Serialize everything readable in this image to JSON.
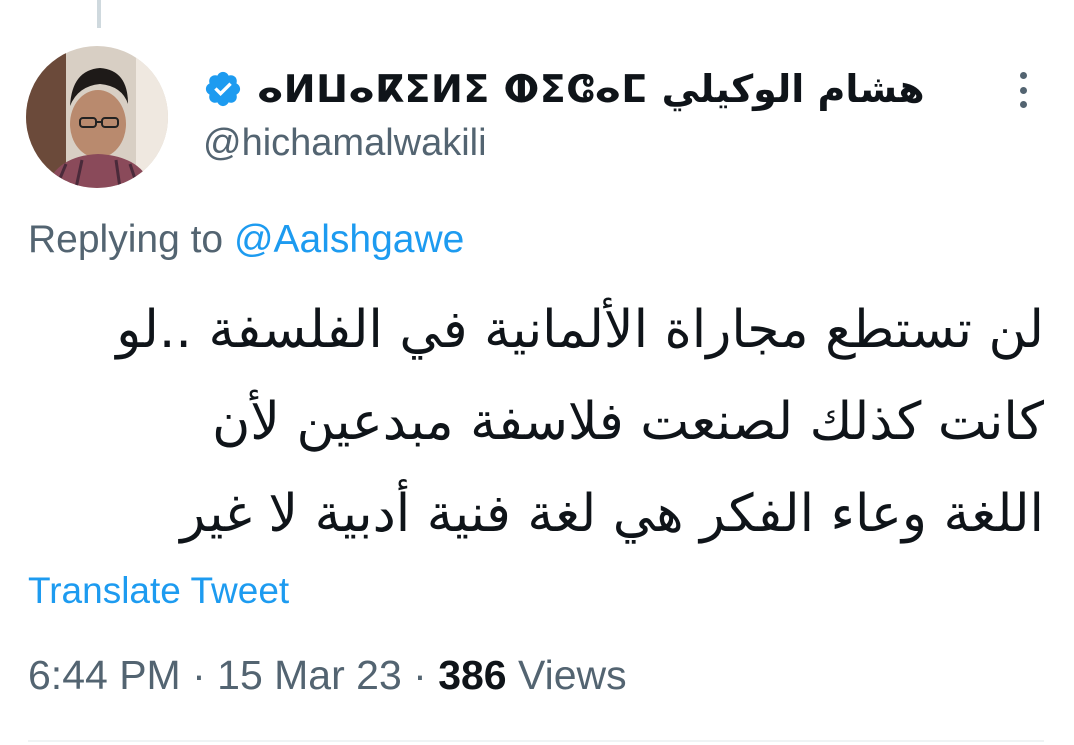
{
  "author": {
    "display_name": "ⴰⵍⵡⴰⴽⵉⵍⵉ ⵀⵉⵛⴰⵎ هشام الوكيلي",
    "handle": "@hichamalwakili",
    "verified": true
  },
  "reply": {
    "prefix": "Replying to ",
    "mention": "@Aalshgawe"
  },
  "tweet": {
    "lines": [
      "لن تستطع مجاراة الألمانية في الفلسفة ..لو",
      "كانت كذلك لصنعت فلاسفة مبدعين لأن",
      "اللغة وعاء الفكر هي لغة  فنية أدبية لا غير"
    ]
  },
  "translate_label": "Translate Tweet",
  "meta": {
    "time": "6:44 PM",
    "separator": " · ",
    "date": "15 Mar 23",
    "views_count": "386",
    "views_label": " Views"
  },
  "colors": {
    "accent": "#1d9bf0",
    "secondary_text": "#536471",
    "primary_text": "#0f1419"
  },
  "icons": [
    "verified-badge-icon",
    "more-options-icon"
  ]
}
